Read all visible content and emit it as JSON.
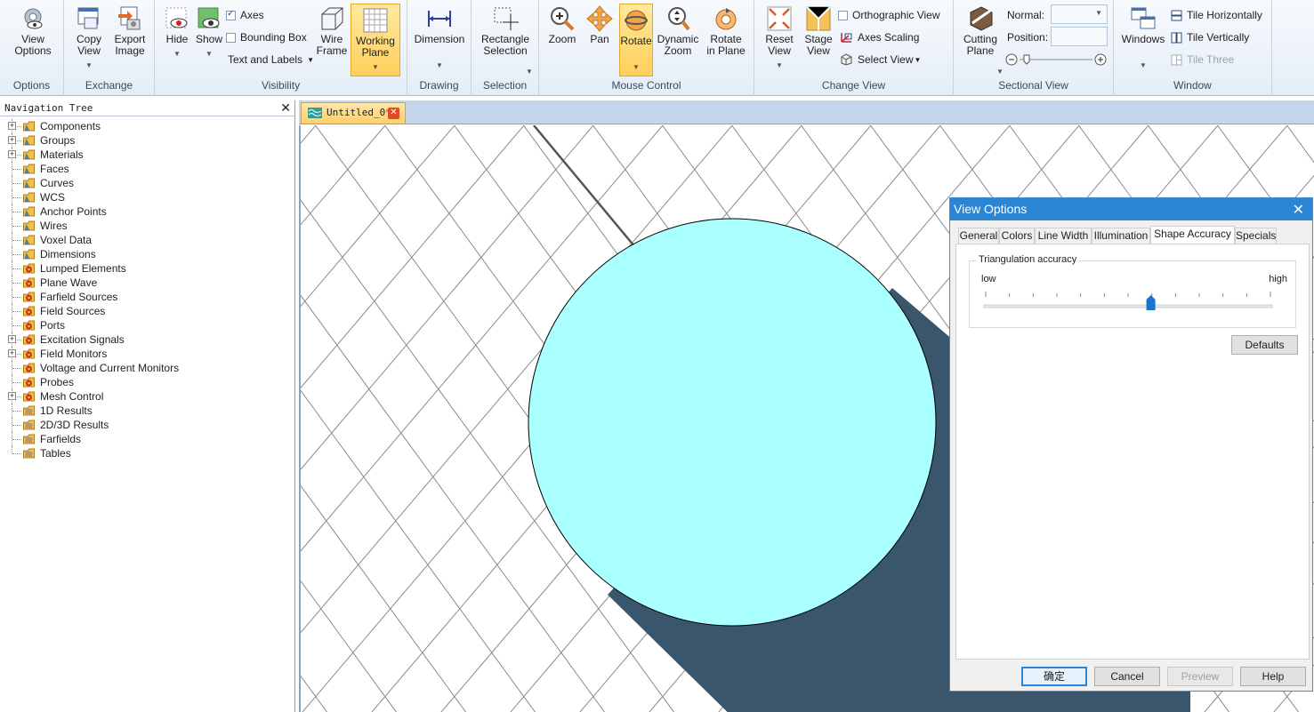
{
  "ribbon": {
    "groups": {
      "options": "Options",
      "exchange": "Exchange",
      "visibility": "Visibility",
      "drawing": "Drawing",
      "selection": "Selection",
      "mouse_control": "Mouse Control",
      "change_view": "Change View",
      "sectional_view": "Sectional View",
      "window": "Window"
    },
    "view_options": [
      "View",
      "Options"
    ],
    "copy_view": [
      "Copy",
      "View"
    ],
    "export_image": [
      "Export",
      "Image"
    ],
    "hide": "Hide",
    "show": "Show",
    "axes": "Axes",
    "bounding_box": "Bounding Box",
    "text_and_labels": "Text and Labels",
    "wire_frame": [
      "Wire",
      "Frame"
    ],
    "working_plane": [
      "Working",
      "Plane"
    ],
    "dimension": "Dimension",
    "rectangle_selection": [
      "Rectangle",
      "Selection"
    ],
    "zoom": "Zoom",
    "pan": "Pan",
    "rotate": "Rotate",
    "dynamic_zoom": [
      "Dynamic",
      "Zoom"
    ],
    "rotate_in_plane": [
      "Rotate",
      "in Plane"
    ],
    "reset_view": [
      "Reset",
      "View"
    ],
    "stage_view": [
      "Stage",
      "View"
    ],
    "orthographic_view": "Orthographic View",
    "axes_scaling": "Axes Scaling",
    "select_view": "Select View",
    "cutting_plane": [
      "Cutting",
      "Plane"
    ],
    "normal_label": "Normal:",
    "position_label": "Position:",
    "windows": "Windows",
    "tile_horizontally": "Tile Horizontally",
    "tile_vertically": "Tile Vertically",
    "tile_three": "Tile Three"
  },
  "nav": {
    "title": "Navigation Tree",
    "items": [
      {
        "label": "Components",
        "expandable": true,
        "icon": "folder"
      },
      {
        "label": "Groups",
        "expandable": true,
        "icon": "folder"
      },
      {
        "label": "Materials",
        "expandable": true,
        "icon": "folder"
      },
      {
        "label": "Faces",
        "expandable": false,
        "icon": "folder"
      },
      {
        "label": "Curves",
        "expandable": false,
        "icon": "folder"
      },
      {
        "label": "WCS",
        "expandable": false,
        "icon": "folder"
      },
      {
        "label": "Anchor Points",
        "expandable": false,
        "icon": "folder"
      },
      {
        "label": "Wires",
        "expandable": false,
        "icon": "folder"
      },
      {
        "label": "Voxel Data",
        "expandable": false,
        "icon": "folder"
      },
      {
        "label": "Dimensions",
        "expandable": false,
        "icon": "folder"
      },
      {
        "label": "Lumped Elements",
        "expandable": false,
        "icon": "gear-folder"
      },
      {
        "label": "Plane Wave",
        "expandable": false,
        "icon": "gear-folder"
      },
      {
        "label": "Farfield Sources",
        "expandable": false,
        "icon": "gear-folder"
      },
      {
        "label": "Field Sources",
        "expandable": false,
        "icon": "gear-folder"
      },
      {
        "label": "Ports",
        "expandable": false,
        "icon": "gear-folder"
      },
      {
        "label": "Excitation Signals",
        "expandable": true,
        "icon": "gear-folder"
      },
      {
        "label": "Field Monitors",
        "expandable": true,
        "icon": "gear-folder"
      },
      {
        "label": "Voltage and Current Monitors",
        "expandable": false,
        "icon": "gear-folder"
      },
      {
        "label": "Probes",
        "expandable": false,
        "icon": "gear-folder"
      },
      {
        "label": "Mesh Control",
        "expandable": true,
        "icon": "gear-folder"
      },
      {
        "label": "1D Results",
        "expandable": false,
        "icon": "stack-folder"
      },
      {
        "label": "2D/3D Results",
        "expandable": false,
        "icon": "stack-folder"
      },
      {
        "label": "Farfields",
        "expandable": false,
        "icon": "stack-folder"
      },
      {
        "label": "Tables",
        "expandable": false,
        "icon": "stack-folder"
      }
    ]
  },
  "document": {
    "tab_title": "Untitled_0*"
  },
  "dialog": {
    "title": "View Options",
    "tabs": [
      "General",
      "Colors",
      "Line Width",
      "Illumination",
      "Shape Accuracy",
      "Specials"
    ],
    "selected_tab": "Shape Accuracy",
    "group_title": "Triangulation accuracy",
    "low_label": "low",
    "high_label": "high",
    "slider_value": 0.58,
    "defaults_button": "Defaults",
    "ok_button": "确定",
    "cancel_button": "Cancel",
    "preview_button": "Preview",
    "help_button": "Help"
  },
  "colors": {
    "cylinder_face": "#aaffff",
    "cylinder_shadow": "#3a566c",
    "dialog_title": "#2a86d5",
    "ribbon_active": "#ffcf5a"
  }
}
